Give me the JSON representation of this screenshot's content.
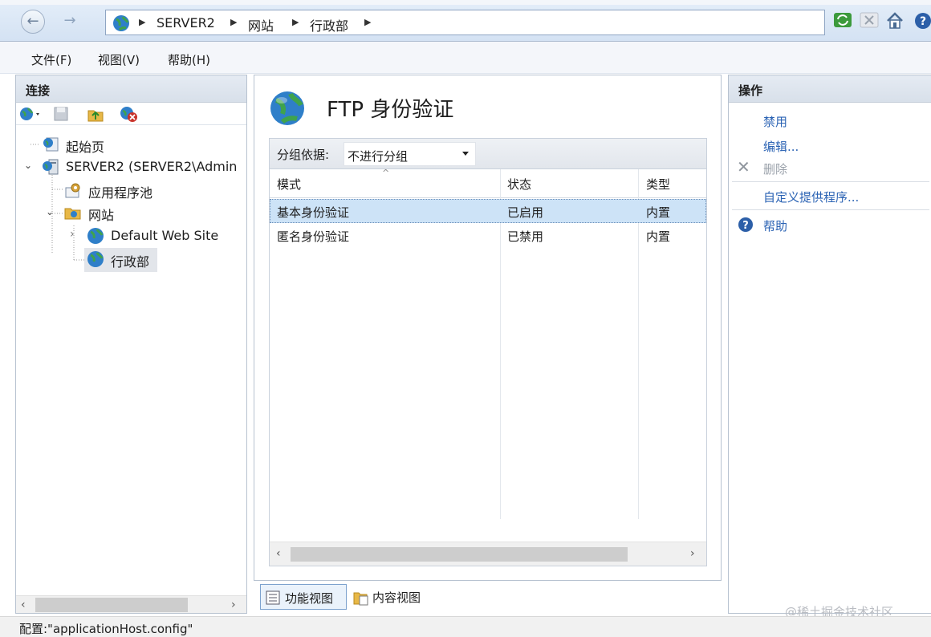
{
  "breadcrumb": [
    "SERVER2",
    "网站",
    "行政部"
  ],
  "menu": [
    "文件(F)",
    "视图(V)",
    "帮助(H)"
  ],
  "connections": {
    "title": "连接",
    "tree": [
      {
        "label": "起始页"
      },
      {
        "label": "SERVER2 (SERVER2\\Admin"
      },
      {
        "label": "应用程序池"
      },
      {
        "label": "网站"
      },
      {
        "label": "Default Web Site"
      },
      {
        "label": "行政部"
      }
    ]
  },
  "feature": {
    "title": "FTP 身份验证",
    "group_label": "分组依据:",
    "group_value": "不进行分组",
    "columns": [
      "模式",
      "状态",
      "类型"
    ],
    "rows": [
      {
        "mode": "基本身份验证",
        "status": "已启用",
        "type": "内置"
      },
      {
        "mode": "匿名身份验证",
        "status": "已禁用",
        "type": "内置"
      }
    ]
  },
  "view_tabs": [
    "功能视图",
    "内容视图"
  ],
  "actions": {
    "title": "操作",
    "items": [
      "禁用",
      "编辑...",
      "删除",
      "自定义提供程序...",
      "帮助"
    ]
  },
  "status": "配置:\"applicationHost.config\"",
  "watermark": "@稀土掘金技术社区",
  "colors": {
    "link": "#2b63b4",
    "selection": "#cde3f7"
  }
}
